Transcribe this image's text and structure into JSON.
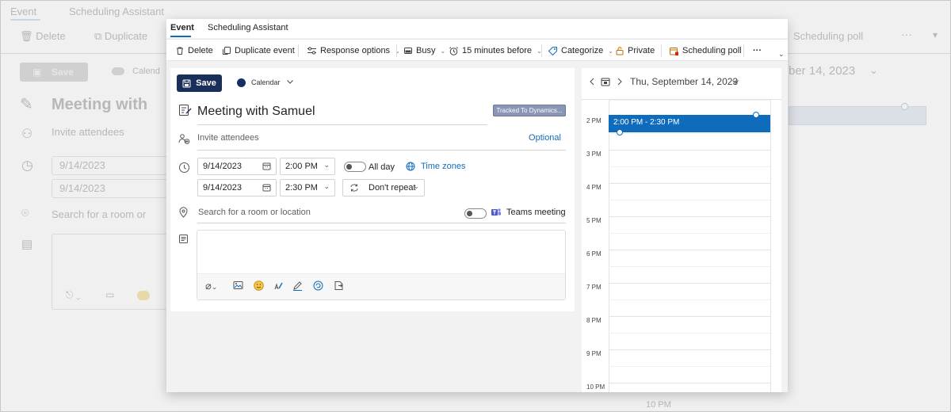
{
  "dialog": {
    "tabs": [
      {
        "label": "Event",
        "active": true
      },
      {
        "label": "Scheduling Assistant",
        "active": false
      }
    ],
    "toolbar": {
      "delete": "Delete",
      "duplicate": "Duplicate event",
      "response_options": "Response options",
      "busy": "Busy",
      "reminder": "15 minutes before",
      "categorize": "Categorize",
      "private": "Private",
      "scheduling_poll": "Scheduling poll",
      "more": "···"
    },
    "form": {
      "save": "Save",
      "calendar": "Calendar",
      "title": "Meeting with Samuel",
      "tracked_badge": "Tracked To Dynamics...",
      "attendees_placeholder": "Invite attendees",
      "optional": "Optional",
      "start_date": "9/14/2023",
      "start_time": "2:00 PM",
      "end_date": "9/14/2023",
      "end_time": "2:30 PM",
      "all_day": "All day",
      "time_zones": "Time zones",
      "repeat": "Don't repeat",
      "location_placeholder": "Search for a room or location",
      "teams_meeting": "Teams meeting"
    },
    "calendar_pane": {
      "date": "Thu, September 14, 2023",
      "hours": [
        "2 PM",
        "3 PM",
        "4 PM",
        "5 PM",
        "6 PM",
        "7 PM",
        "8 PM",
        "9 PM",
        "10 PM"
      ],
      "event_label": "2:00 PM - 2:30 PM"
    }
  },
  "background": {
    "tabs": [
      "Event",
      "Scheduling Assistant"
    ],
    "toolbar": [
      "Delete",
      "Duplicate"
    ],
    "save": "Save",
    "calendar": "Calend",
    "title": "Meeting with",
    "attendees": "Invite attendees",
    "start_date": "9/14/2023",
    "end_date": "9/14/2023",
    "location": "Search for a room or",
    "scheduling_poll": "Scheduling poll",
    "more": "···",
    "date": "ber 14, 2023",
    "hour_label": "10 PM"
  },
  "colors": {
    "accent": "#0f6cbd",
    "save_button": "#1a2e5a",
    "calendar_dot": "#142f63",
    "badge": "#8b95b5"
  }
}
